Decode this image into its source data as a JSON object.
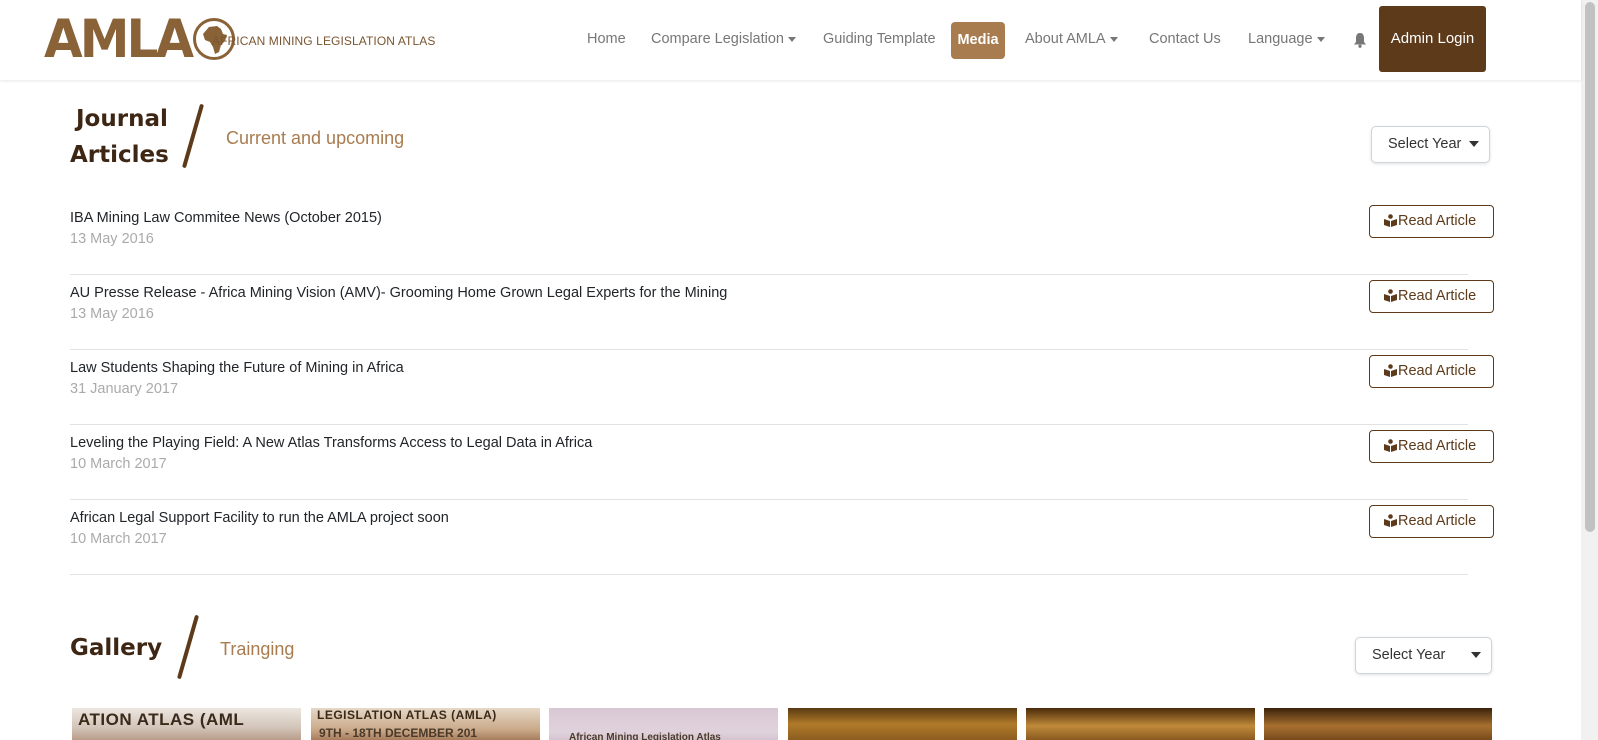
{
  "brand": {
    "logo_text": "AMLA",
    "subtitle": "AFRICAN MINING LEGISLATION ATLAS"
  },
  "nav": {
    "home": "Home",
    "compare": "Compare Legislation",
    "guiding": "Guiding Template",
    "media": "Media",
    "about": "About AMLA",
    "contact": "Contact Us",
    "language": "Language",
    "admin": "Admin Login"
  },
  "journal": {
    "title_line1": "Journal",
    "title_line2": "Articles",
    "subtitle": "Current and upcoming",
    "select_year": "Select Year",
    "read_label": "Read Article",
    "articles": [
      {
        "title": "IBA Mining Law Commitee News (October 2015)",
        "date": "13 May 2016"
      },
      {
        "title": "AU Presse Release - Africa Mining Vision (AMV)- Grooming Home Grown Legal Experts for the Mining",
        "date": "13 May 2016"
      },
      {
        "title": "Law Students Shaping the Future of Mining in Africa",
        "date": "31 January 2017"
      },
      {
        "title": "Leveling the Playing Field: A New Atlas Transforms Access to Legal Data in Africa",
        "date": "10 March 2017"
      },
      {
        "title": "African Legal Support Facility to run the AMLA project soon",
        "date": "10 March 2017"
      }
    ]
  },
  "gallery": {
    "title": "Gallery",
    "subtitle": "Trainging",
    "select_year": "Select Year",
    "thumbs": [
      {
        "text": "ATION ATLAS (AML",
        "sub": ""
      },
      {
        "text": "LEGISLATION ATLAS (AMLA)",
        "sub": "9TH - 18TH DECEMBER 201"
      },
      {
        "text": "",
        "sub": "African Mining Legislation Atlas"
      },
      {
        "text": "",
        "sub": ""
      },
      {
        "text": "",
        "sub": ""
      },
      {
        "text": "",
        "sub": ""
      }
    ]
  },
  "colors": {
    "brand_brown": "#8a6238",
    "dark_brown": "#5c3a1a",
    "accent": "#a87c4f"
  }
}
